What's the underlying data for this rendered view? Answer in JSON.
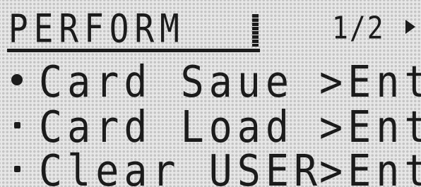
{
  "header": {
    "title": "PERFORM",
    "page_indicator": "1/2",
    "next_page_icon": "triangle-right-icon"
  },
  "menu": {
    "items": [
      {
        "label": "Card Saue",
        "action": ">Ent",
        "selected": true
      },
      {
        "label": "Card Load",
        "action": ">Ent",
        "selected": false
      },
      {
        "label": "Clear USER",
        "action": ">Ent",
        "selected": false
      }
    ]
  },
  "colors": {
    "lcd_background": "#e7e7e7",
    "pixel_on": "#1b1b1b",
    "pixel_off": "#c4c4c4"
  }
}
